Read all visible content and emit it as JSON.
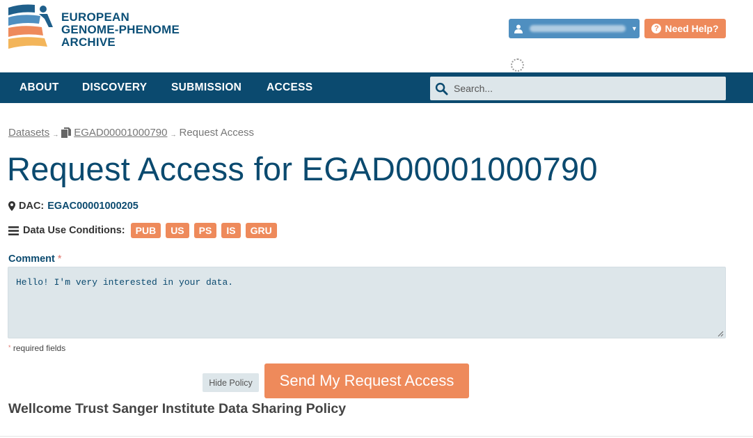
{
  "logo": {
    "line1": "EUROPEAN",
    "line2": "GENOME-PHENOME",
    "line3": "ARCHIVE",
    "colors": {
      "blue": "#1f5f8b",
      "lightblue": "#4f8fc0",
      "orange": "#ee8a5b",
      "yellow": "#f3b55a"
    }
  },
  "header": {
    "user_icon": "user-icon",
    "help_label": "Need Help?",
    "help_icon": "question-circle-icon"
  },
  "nav": {
    "items": [
      {
        "label": "ABOUT"
      },
      {
        "label": "DISCOVERY"
      },
      {
        "label": "SUBMISSION"
      },
      {
        "label": "ACCESS"
      }
    ],
    "search_placeholder": "Search..."
  },
  "breadcrumb": {
    "datasets": "Datasets",
    "dataset_id": "EGAD00001000790",
    "current": "Request Access"
  },
  "page_title": "Request Access for EGAD00001000790",
  "dac": {
    "label": "DAC:",
    "value": "EGAC00001000205"
  },
  "data_use": {
    "label": "Data Use Conditions:",
    "tags": [
      "PUB",
      "US",
      "PS",
      "IS",
      "GRU"
    ]
  },
  "comment": {
    "label": "Comment",
    "required_marker": "*",
    "value": "Hello! I'm very interested in your data."
  },
  "required_note": "required fields",
  "buttons": {
    "hide_policy": "Hide Policy",
    "send": "Send My Request Access"
  },
  "policy_title": "Wellcome Trust Sanger Institute Data Sharing Policy",
  "colors": {
    "navbar": "#0b4a6f",
    "accent": "#ee8a5b",
    "input_bg": "#dde6ea",
    "user_button": "#4f8fc0"
  }
}
